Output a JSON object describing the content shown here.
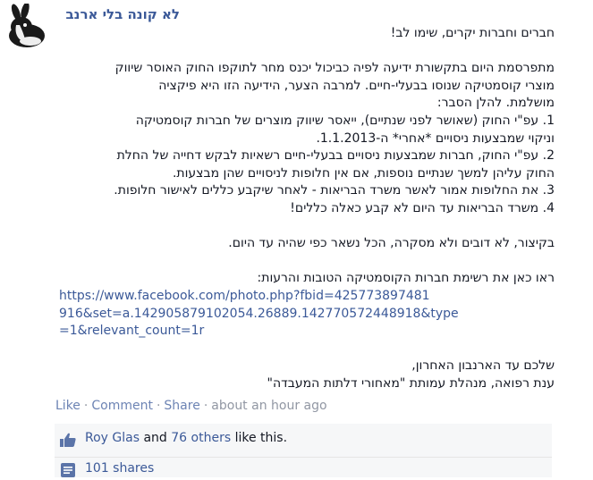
{
  "post": {
    "page_name": "לא קונה בלי ארנב",
    "lines": [
      "חברים וחברות יקרים, שימו לב!",
      "",
      "מתפרסמת היום בתקשורת ידיעה לפיה כביכול יכנס מחר לתוקפו החוק האוסר שיווק",
      "מוצרי קוסמטיקה שנוסו בבעלי-חיים. למרבה הצער, הידיעה הזו היא פיקציה",
      "מושלמת. להלן הסבר:",
      "1. עפ\"י החוק (שאושר לפני שנתיים), ייאסר שיווק מוצרים של חברות קוסמטיקה",
      "וניקוי שמבצעות ניסויים *אחרי* ה-1.1.2013.",
      "2. עפ\"י החוק, חברות שמבצעות ניסויים בבעלי-חיים רשאיות לבקש דחייה של החלת",
      "החוק עליהן למשך שנתיים נוספות, אם אין חלופות לניסויים שהן מבצעות.",
      "3. את החלופות אמור לאשר משרד הבריאות - לאחר שיקבע כללים לאישור חלופות.",
      "4. משרד הבריאות עד היום לא קבע כאלה כללים!",
      "",
      "בקיצור, לא דובים ולא מסקרה, הכל נשאר כפי שהיה עד היום.",
      "",
      "ראו כאן את רשימת חברות הקוסמטיקה הטובות והרעות:"
    ],
    "link_lines": [
      "https://www.facebook.com/photo.php?fbid=425773897481",
      "916&set=a.142905879102054.26889.142770572448918&type",
      "=1&relevant_count=1r"
    ],
    "signature_lines": [
      "שלכם עד הארנבון האחרון,",
      "ענת רפואה, מנהלת עמותת \"מאחורי דלתות המעבדה\""
    ]
  },
  "actions": {
    "like": "Like",
    "comment": "Comment",
    "share": "Share",
    "separator": "·",
    "time": "about an hour ago"
  },
  "ufi": {
    "liker_name": "Roy Glas",
    "likes_and": "and",
    "others_link": "76 others",
    "likes_suffix": "like this.",
    "shares_text": "101 shares"
  },
  "colors": {
    "link": "#3b5998",
    "action_link": "#6d84b4",
    "meta_gray": "#9197a3",
    "ufi_background": "#f6f7f8"
  },
  "icons": {
    "avatar": "rabbit-avatar",
    "likes": "thumbs-up-icon",
    "shares": "share-icon"
  }
}
